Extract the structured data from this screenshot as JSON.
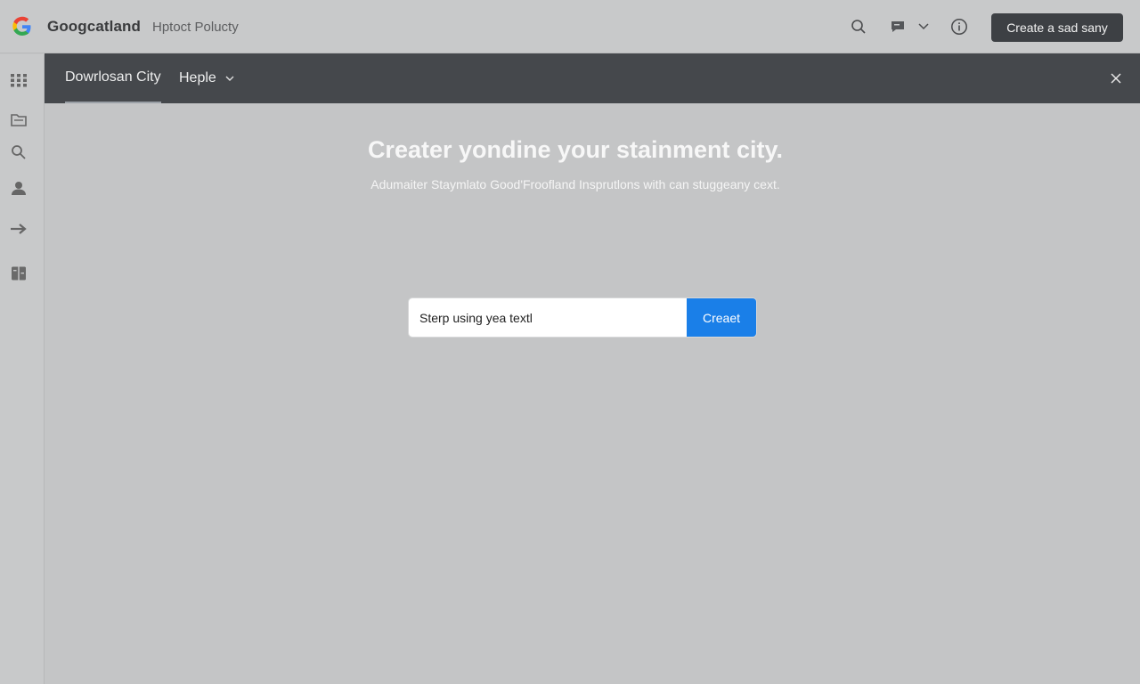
{
  "header": {
    "brand": "Googcatland",
    "brand_sub": "Hptoct Polucty",
    "cta_label": "Create a sad sany",
    "icons": [
      "search-icon",
      "chat-icon",
      "chevron-down-icon",
      "info-icon"
    ]
  },
  "sidebar": {
    "icons": [
      "apps-grid-icon",
      "folder-icon",
      "search-icon",
      "person-icon",
      "arrow-right-icon",
      "book-icon"
    ]
  },
  "tabs": [
    {
      "label": "Dowrlosan City",
      "active": true
    },
    {
      "label": "Heple",
      "has_dropdown": true
    }
  ],
  "main": {
    "headline": "Creater yondine your stainment city.",
    "subline": "Adumaiter Staymlato Good'Froofland Insprutlons with can stuggeany cext.",
    "input_value": "Sterp using yea textl",
    "submit_label": "Creaet"
  },
  "colors": {
    "accent": "#1a7fe8",
    "tabbar": "#45484c",
    "background": "#c4c5c6"
  }
}
